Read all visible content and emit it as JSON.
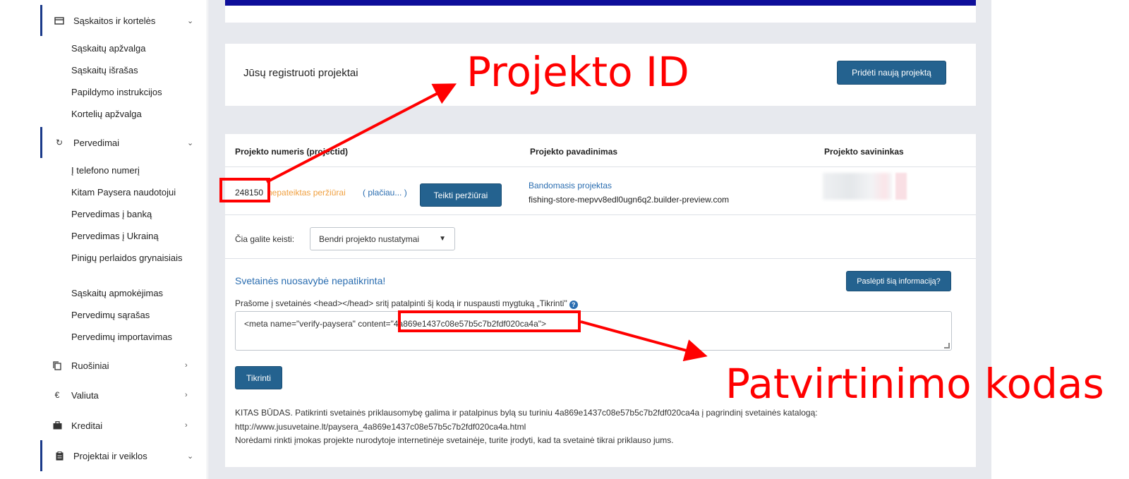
{
  "sidebar": {
    "sections": [
      {
        "label": "Sąskaitos ir kortelės",
        "icon": "wallet-icon",
        "chevron": "chevron-down-icon"
      },
      {
        "label": "Pervedimai",
        "icon": "refresh-icon",
        "chevron": "chevron-down-icon"
      },
      {
        "label": "Ruošiniai",
        "icon": "copy-icon",
        "chevron": "chevron-right-icon"
      },
      {
        "label": "Valiuta",
        "icon": "euro-icon",
        "chevron": "chevron-right-icon"
      },
      {
        "label": "Kreditai",
        "icon": "briefcase-icon",
        "chevron": "chevron-right-icon"
      },
      {
        "label": "Projektai ir veiklos",
        "icon": "clipboard-icon",
        "chevron": "chevron-down-icon"
      }
    ],
    "accounts_items": [
      "Sąskaitų apžvalga",
      "Sąskaitų išrašas",
      "Papildymo instrukcijos",
      "Kortelių apžvalga"
    ],
    "transfer_items": [
      "Į telefono numerį",
      "Kitam Paysera naudotojui",
      "Pervedimas į banką",
      "Pervedimas į Ukrainą",
      "Pinigų perlaidos grynaisiais",
      "Sąskaitų apmokėjimas",
      "Pervedimų sąrašas",
      "Pervedimų importavimas"
    ]
  },
  "projects": {
    "title": "Jūsų registruoti projektai",
    "add_button": "Pridėti naują projektą"
  },
  "table": {
    "headers": [
      "Projekto numeris (projectid)",
      "Projekto pavadinimas",
      "Projekto savininkas"
    ],
    "row": {
      "id": "248150",
      "status": "nepateiktas peržiūrai",
      "more": "( plačiau... )",
      "review_button": "Teikti peržiūrai",
      "name": "Bandomasis projektas",
      "domain": "fishing-store-mepvv8edl0ugn6q2.builder-preview.com"
    }
  },
  "settings": {
    "change_label": "Čia galite keisti:",
    "select_value": "Bendri projekto nustatymai"
  },
  "verification": {
    "title": "Svetainės nuosavybė nepatikrinta!",
    "hide_button": "Paslėpti šią informaciją?",
    "instruction": "Prašome į svetainės <head></head> sritį patalpinti šį kodą ir nuspausti mygtuką „Tikrinti\"",
    "meta_code": "<meta name=\"verify-paysera\" content=\"4a869e1437c08e57b5c7b2fdf020ca4a\">",
    "verify_button": "Tikrinti",
    "other_lines": [
      "KITAS BŪDAS. Patikrinti svetainės priklausomybę galima ir patalpinus bylą su turiniu 4a869e1437c08e57b5c7b2fdf020ca4a į pagrindinį svetainės katalogą:",
      "http://www.jusuvetaine.lt/paysera_4a869e1437c08e57b5c7b2fdf020ca4a.html",
      "Norėdami rinkti įmokas projekte nurodytoje internetinėje svetainėje, turite įrodyti, kad ta svetainė tikrai priklauso jums."
    ]
  },
  "annotations": {
    "id_label": "Projekto ID",
    "code_label": "Patvirtinimo kodas",
    "color": "#ff0000"
  }
}
